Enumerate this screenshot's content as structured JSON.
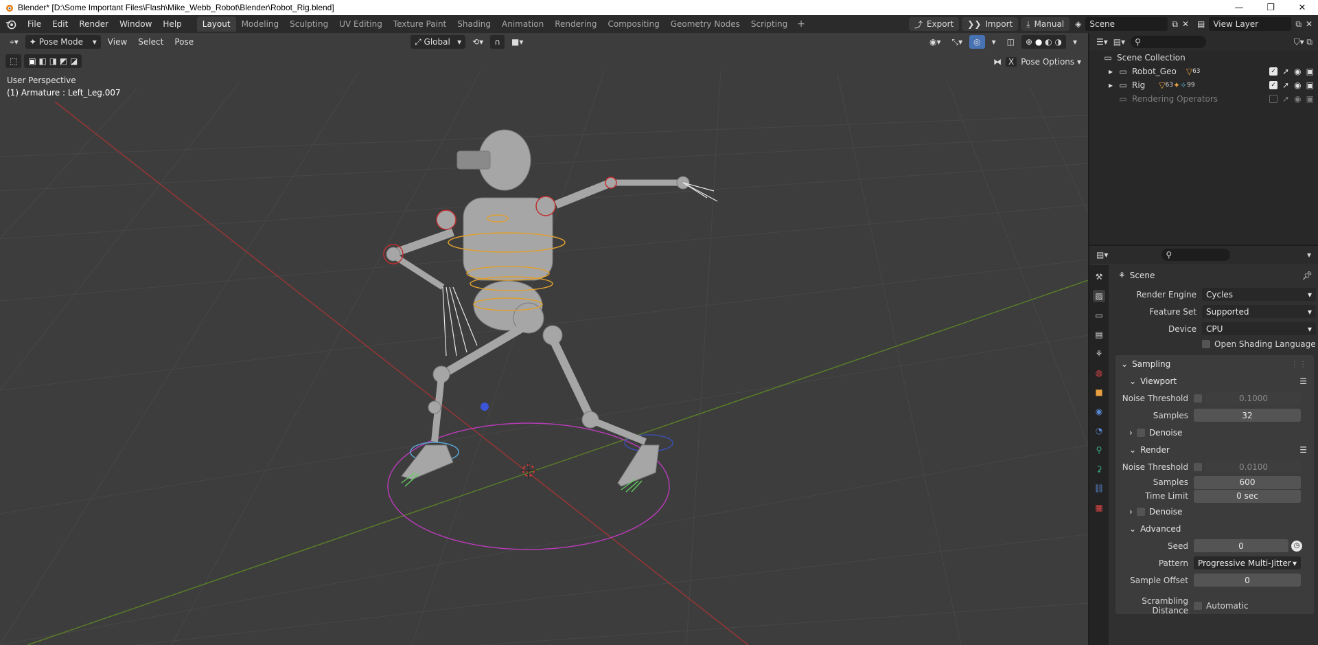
{
  "window": {
    "title": "Blender* [D:\\Some Important Files\\Flash\\Mike_Webb_Robot\\Blender\\Robot_Rig.blend]",
    "minimize": "—",
    "maximize": "❐",
    "close": "✕"
  },
  "menu": [
    "File",
    "Edit",
    "Render",
    "Window",
    "Help"
  ],
  "workspaces": {
    "tabs": [
      "Layout",
      "Modeling",
      "Sculpting",
      "UV Editing",
      "Texture Paint",
      "Shading",
      "Animation",
      "Rendering",
      "Compositing",
      "Geometry Nodes",
      "Scripting"
    ],
    "active": "Layout",
    "add": "+"
  },
  "topright": {
    "export": "Export",
    "import": "Import",
    "manual": "Manual",
    "scene": "Scene",
    "view_layer": "View Layer"
  },
  "viewport": {
    "mode": "Pose Mode",
    "menus": [
      "View",
      "Select",
      "Pose"
    ],
    "orientation": "Global",
    "perspective": "User Perspective",
    "active_bone": "(1) Armature : Left_Leg.007",
    "pose_options": "Pose Options",
    "x_label": "X"
  },
  "outliner": {
    "root": "Scene Collection",
    "items": [
      {
        "name": "Robot_Geo",
        "badge": "63"
      },
      {
        "name": "Rig",
        "badge": "63",
        "badge2": "99"
      },
      {
        "name": "Rendering Operators",
        "dim": true
      }
    ]
  },
  "properties": {
    "context": "Scene",
    "render_engine_label": "Render Engine",
    "render_engine": "Cycles",
    "feature_set_label": "Feature Set",
    "feature_set": "Supported",
    "device_label": "Device",
    "device": "CPU",
    "osl_label": "Open Shading Language",
    "sampling": {
      "title": "Sampling",
      "viewport_title": "Viewport",
      "viewport_noise_label": "Noise Threshold",
      "viewport_noise": "0.1000",
      "viewport_samples_label": "Samples",
      "viewport_samples": "32",
      "viewport_denoise": "Denoise",
      "render_title": "Render",
      "render_noise_label": "Noise Threshold",
      "render_noise": "0.0100",
      "render_samples_label": "Samples",
      "render_samples": "600",
      "time_limit_label": "Time Limit",
      "time_limit": "0 sec",
      "render_denoise": "Denoise",
      "advanced_title": "Advanced",
      "seed_label": "Seed",
      "seed": "0",
      "pattern_label": "Pattern",
      "pattern": "Progressive Multi-Jitter",
      "sample_offset_label": "Sample Offset",
      "sample_offset": "0",
      "scrambling_label": "Scrambling Distance",
      "scrambling_value": "Automatic"
    }
  },
  "colors": {
    "viewport_bg": "#3d3d3d",
    "accent": "#4772b3",
    "x_axis": "#c04040",
    "y_axis": "#6b9a2a",
    "pose_circle": "#b43cb4"
  }
}
